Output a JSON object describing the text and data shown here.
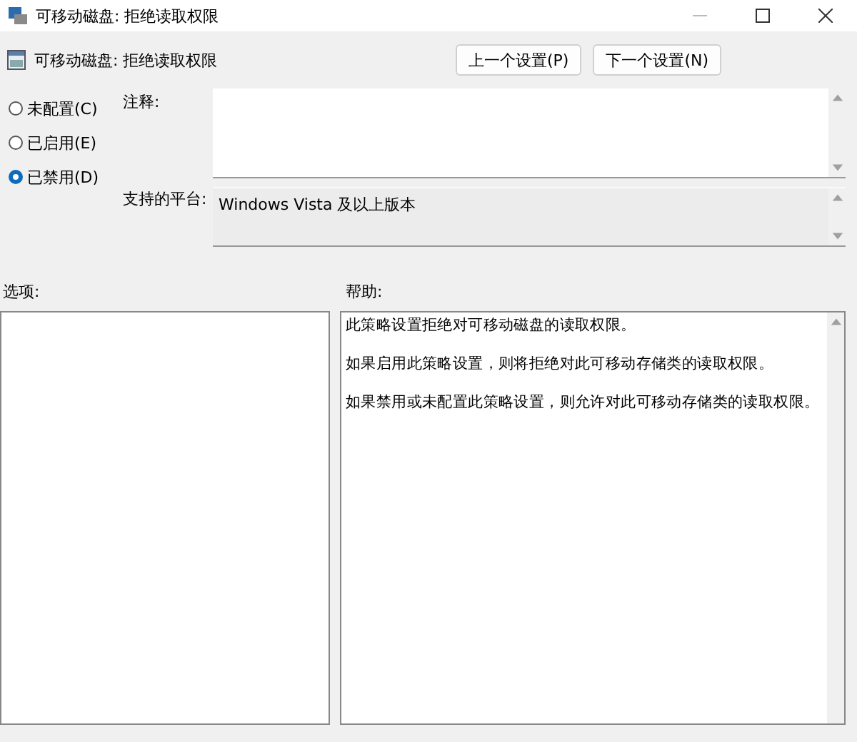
{
  "window": {
    "title": "可移动磁盘: 拒绝读取权限"
  },
  "header": {
    "title": "可移动磁盘: 拒绝读取权限",
    "buttons": [
      "上一个设置(P)",
      "下一个设置(N)"
    ]
  },
  "options": [
    {
      "label": "未配置(C)",
      "selected": false
    },
    {
      "label": "已启用(E)",
      "selected": false
    },
    {
      "label": "已禁用(D)",
      "selected": true
    }
  ],
  "comment": {
    "label": "注释:"
  },
  "platform": {
    "label": "支持的平台:",
    "value": "Windows Vista 及以上版本"
  },
  "options_label": "选项:",
  "help": {
    "label": "帮助:",
    "paragraphs": [
      "此策略设置拒绝对可移动磁盘的读取权限。",
      "如果启用此策略设置，则将拒绝对此可移动存储类的读取权限。",
      "如果禁用或未配置此策略设置，则允许对此可移动存储类的读取权限。"
    ]
  }
}
